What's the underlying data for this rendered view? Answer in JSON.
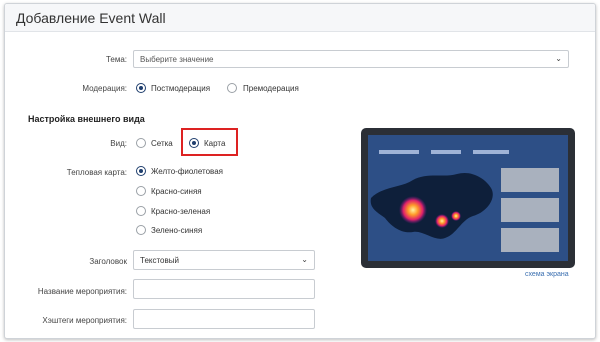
{
  "dialog": {
    "title": "Добавление Event Wall"
  },
  "form": {
    "theme": {
      "label": "Тема:",
      "placeholder": "Выберите значение"
    },
    "moderation": {
      "label": "Модерация:",
      "options": [
        "Постмодерация",
        "Премодерация"
      ],
      "selected": "Постмодерация"
    },
    "appearance_section": "Настройка внешнего вида",
    "view": {
      "label": "Вид:",
      "options": [
        "Сетка",
        "Карта"
      ],
      "selected": "Карта"
    },
    "heatmap": {
      "label": "Тепловая карта:",
      "options": [
        "Желто-фиолетовая",
        "Красно-синяя",
        "Красно-зеленая",
        "Зелено-синяя"
      ],
      "selected": "Желто-фиолетовая"
    },
    "header_select": {
      "label": "Заголовок",
      "value": "Текстовый"
    },
    "event_name": {
      "label": "Название мероприятия:",
      "value": ""
    },
    "hashtags": {
      "label": "Хэштеги мероприятия:",
      "value": ""
    }
  },
  "preview": {
    "caption": "схема экрана"
  },
  "colors": {
    "accent": "#1f3e6d",
    "highlight": "#dd2222",
    "screen_bg": "#2d4f86",
    "bezel": "#2b2f36"
  }
}
